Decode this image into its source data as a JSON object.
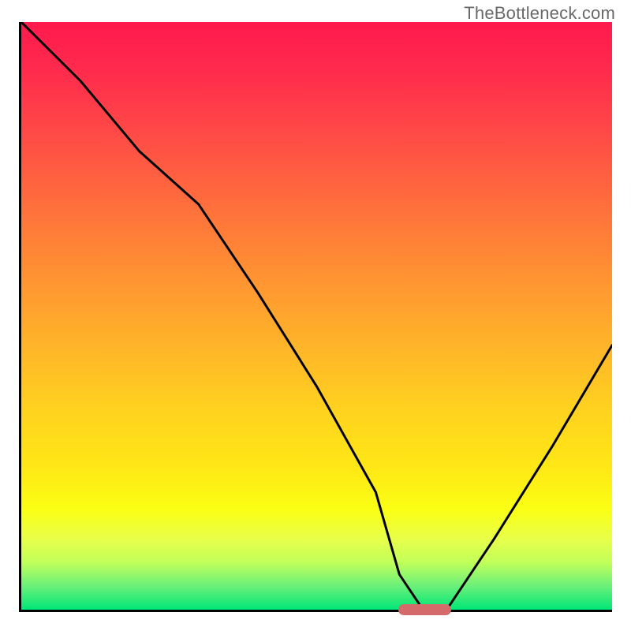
{
  "watermark": "TheBottleneck.com",
  "chart_data": {
    "type": "line",
    "title": "",
    "xlabel": "",
    "ylabel": "",
    "xlim": [
      0,
      100
    ],
    "ylim": [
      0,
      100
    ],
    "x": [
      0,
      10,
      20,
      30,
      40,
      50,
      60,
      64,
      68,
      72,
      80,
      90,
      100
    ],
    "values": [
      100,
      90,
      78,
      69,
      54,
      38,
      20,
      6,
      0,
      0,
      12,
      28,
      45
    ],
    "optimum_range_x": [
      64,
      73
    ],
    "optimum_y": 0,
    "gradient_meaning": "vertical color gradient: red (top) = high bottleneck, green (bottom) = low bottleneck"
  },
  "marker": {
    "left_pct": 63.5,
    "width_pct": 9,
    "color": "#d46a6a"
  }
}
